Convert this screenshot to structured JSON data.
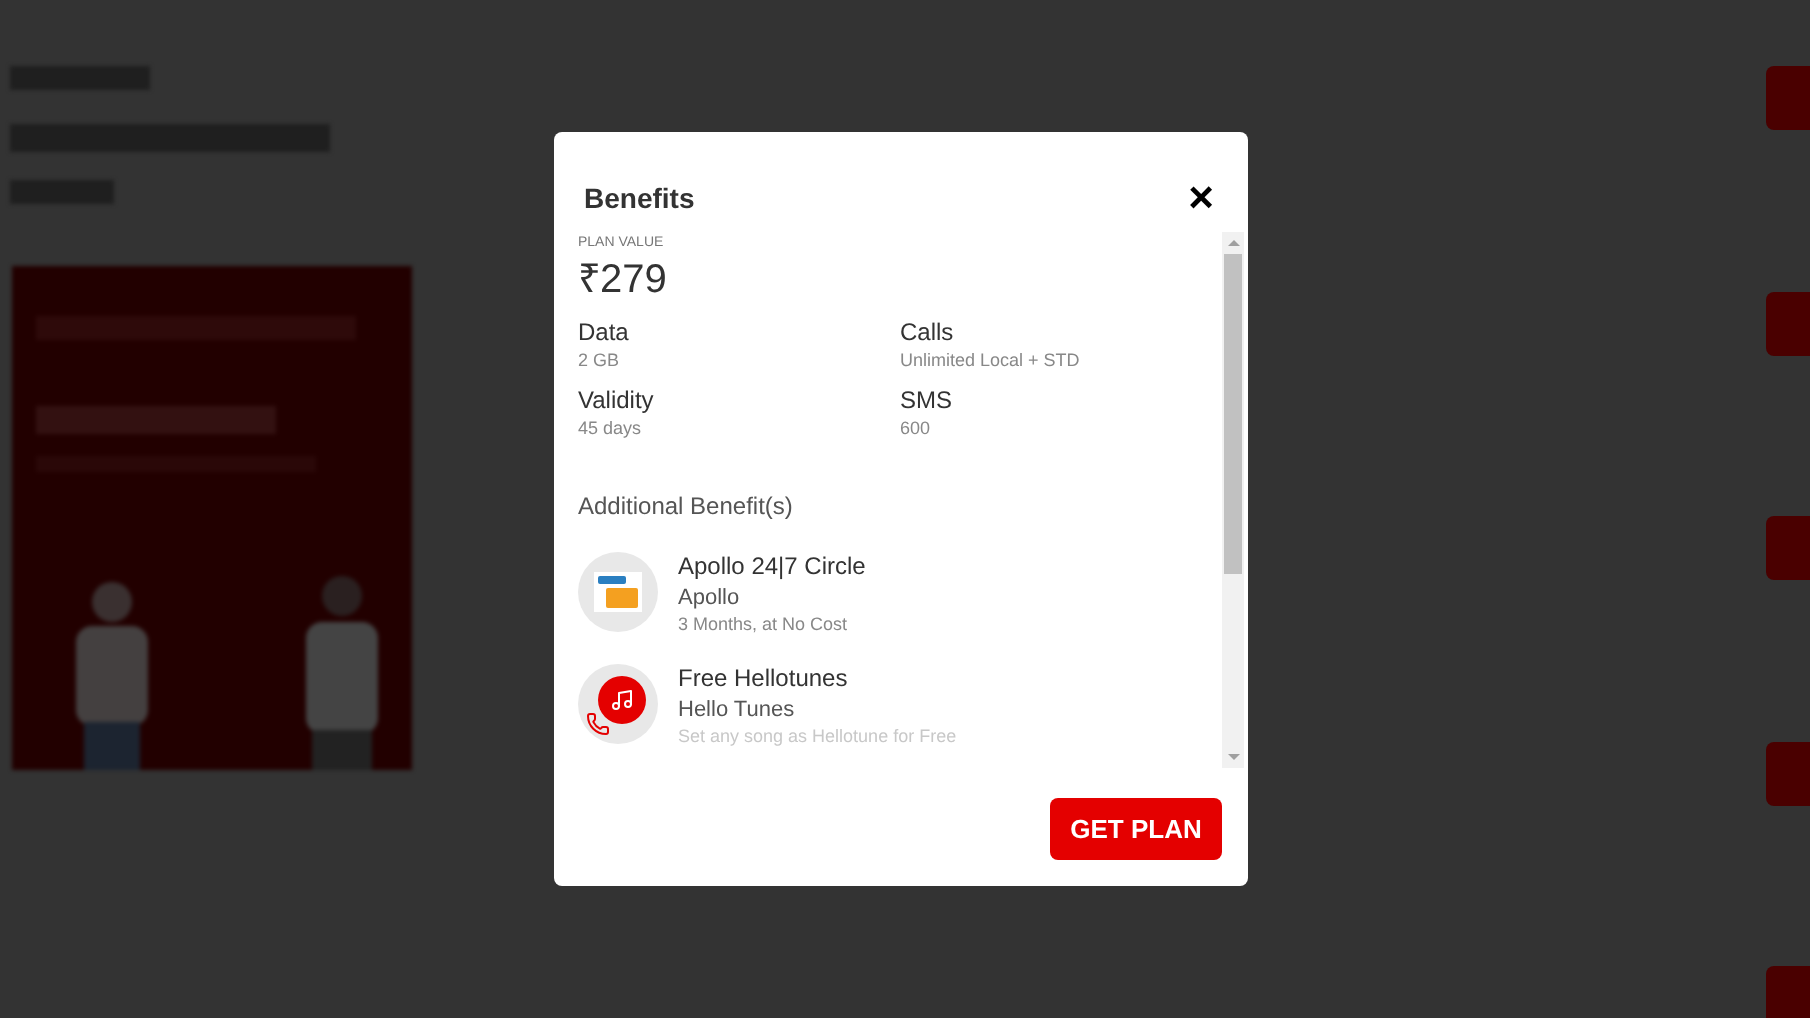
{
  "background": {
    "kind": "dimmed-page"
  },
  "modal": {
    "title": "Benefits",
    "close_icon": "×",
    "plan_value": {
      "label": "PLAN VALUE",
      "value": "₹279"
    },
    "specs": [
      {
        "label": "Data",
        "value": "2 GB"
      },
      {
        "label": "Calls",
        "value": "Unlimited Local + STD"
      },
      {
        "label": "Validity",
        "value": "45 days"
      },
      {
        "label": "SMS",
        "value": "600"
      }
    ],
    "additional_heading": "Additional Benefit(s)",
    "benefits": [
      {
        "kind": "apollo",
        "title": "Apollo 24|7 Circle",
        "provider": "Apollo",
        "detail": "3 Months, at No Cost"
      },
      {
        "kind": "hellotunes",
        "title": "Free Hellotunes",
        "provider": "Hello Tunes",
        "detail": "Set any song as Hellotune for Free"
      }
    ],
    "button": "GET PLAN"
  }
}
